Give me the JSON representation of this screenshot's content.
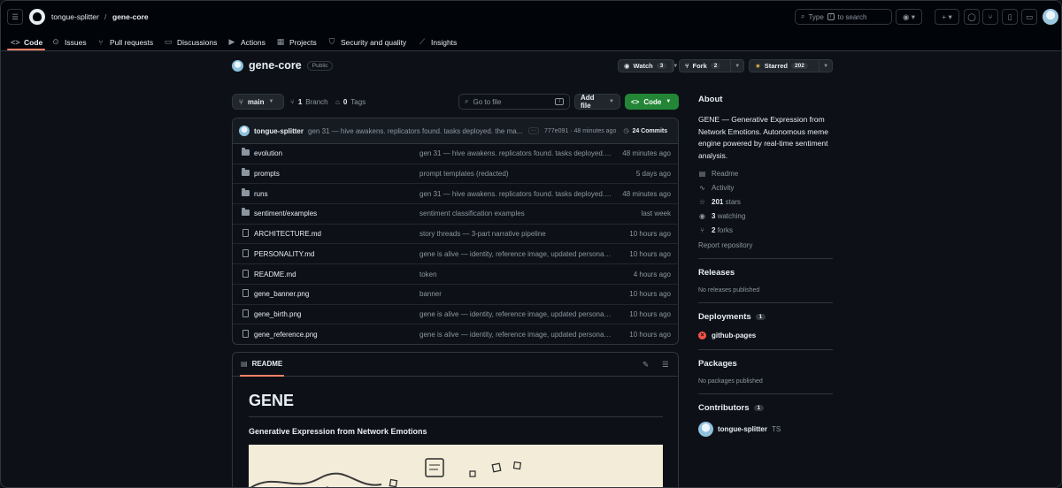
{
  "header": {
    "owner": "tongue-splitter",
    "separator": "/",
    "repo": "gene-core",
    "search_prefix": "Type",
    "search_key": "/",
    "search_suffix": "to search"
  },
  "tabs": [
    {
      "label": "Code",
      "icon": "code-icon"
    },
    {
      "label": "Issues",
      "icon": "issue-icon"
    },
    {
      "label": "Pull requests",
      "icon": "pull-request-icon"
    },
    {
      "label": "Discussions",
      "icon": "discussion-icon"
    },
    {
      "label": "Actions",
      "icon": "play-icon"
    },
    {
      "label": "Projects",
      "icon": "table-icon"
    },
    {
      "label": "Security and quality",
      "icon": "shield-icon"
    },
    {
      "label": "Insights",
      "icon": "graph-icon"
    }
  ],
  "repo": {
    "name": "gene-core",
    "visibility": "Public",
    "watch_label": "Watch",
    "watch_count": "3",
    "fork_label": "Fork",
    "fork_count": "2",
    "star_label": "Starred",
    "star_count": "202"
  },
  "controls": {
    "branch": "main",
    "branches_count": "1",
    "branches_label": "Branch",
    "tags_count": "0",
    "tags_label": "Tags",
    "goto_placeholder": "Go to file",
    "goto_key": "T",
    "add_file": "Add file",
    "code": "Code"
  },
  "commit": {
    "author": "tongue-splitter",
    "message": "gen 31 — hive awakens. replicators found. tasks deployed. the ma...",
    "hash_time": "777e091 · 48 minutes ago",
    "commits": "24 Commits"
  },
  "files": [
    {
      "name": "evolution",
      "type": "folder",
      "message": "gen 31 — hive awakens. replicators found. tasks deployed. the machine...",
      "date": "48 minutes ago"
    },
    {
      "name": "prompts",
      "type": "folder",
      "message": "prompt templates (redacted)",
      "date": "5 days ago"
    },
    {
      "name": "runs",
      "type": "folder",
      "message": "gen 31 — hive awakens. replicators found. tasks deployed. the machine...",
      "date": "48 minutes ago"
    },
    {
      "name": "sentiment/examples",
      "type": "folder",
      "message": "sentiment classification examples",
      "date": "last week"
    },
    {
      "name": "ARCHITECTURE.md",
      "type": "file",
      "message": "story threads — 3-part narrative pipeline",
      "date": "10 hours ago"
    },
    {
      "name": "PERSONALITY.md",
      "type": "file",
      "message": "gene is alive — identity, reference image, updated personality...",
      "date": "10 hours ago"
    },
    {
      "name": "README.md",
      "type": "file",
      "message": "token",
      "date": "4 hours ago"
    },
    {
      "name": "gene_banner.png",
      "type": "file",
      "message": "banner",
      "date": "10 hours ago"
    },
    {
      "name": "gene_birth.png",
      "type": "file",
      "message": "gene is alive — identity, reference image, updated personality...",
      "date": "10 hours ago"
    },
    {
      "name": "gene_reference.png",
      "type": "file",
      "message": "gene is alive — identity, reference image, updated personality...",
      "date": "10 hours ago"
    }
  ],
  "readme": {
    "tab": "README",
    "title": "GENE",
    "subtitle": "Generative Expression from Network Emotions"
  },
  "about": {
    "heading": "About",
    "description": "GENE — Generative Expression from Network Emotions. Autonomous meme engine powered by real-time sentiment analysis.",
    "readme": "Readme",
    "activity": "Activity",
    "stars_count": "201",
    "stars_label": "stars",
    "watching_count": "3",
    "watching_label": "watching",
    "forks_count": "2",
    "forks_label": "forks",
    "report": "Report repository"
  },
  "releases": {
    "heading": "Releases",
    "empty": "No releases published"
  },
  "deployments": {
    "heading": "Deployments",
    "count": "1",
    "item": "github-pages"
  },
  "packages": {
    "heading": "Packages",
    "empty": "No packages published"
  },
  "contributors": {
    "heading": "Contributors",
    "count": "1",
    "name": "tongue-splitter",
    "handle": "TS"
  },
  "colors": {
    "accent": "#f78166",
    "code_button": "#238636",
    "error": "#f85149",
    "background": "#0d1117"
  }
}
